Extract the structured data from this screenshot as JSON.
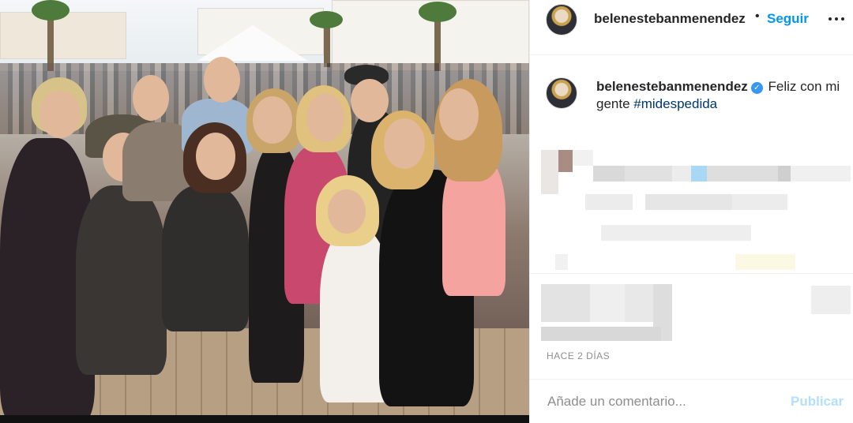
{
  "post": {
    "username": "belenestebanmenendez",
    "follow_label": "Seguir",
    "separator": "•",
    "caption_text": "Feliz con mi gente",
    "hashtag": "#midespedida",
    "verified_icon": "verified-badge-icon",
    "more_icon": "more-options-icon",
    "timestamp": "HACE 2 DÍAS"
  },
  "comment": {
    "placeholder": "Añade un comentario...",
    "publish_label": "Publicar"
  },
  "colors": {
    "link_blue": "#0095f6",
    "hashtag_blue": "#00376b",
    "publish_disabled": "#b2dffc",
    "verified": "#3897f0",
    "muted": "#8e8e8e"
  }
}
